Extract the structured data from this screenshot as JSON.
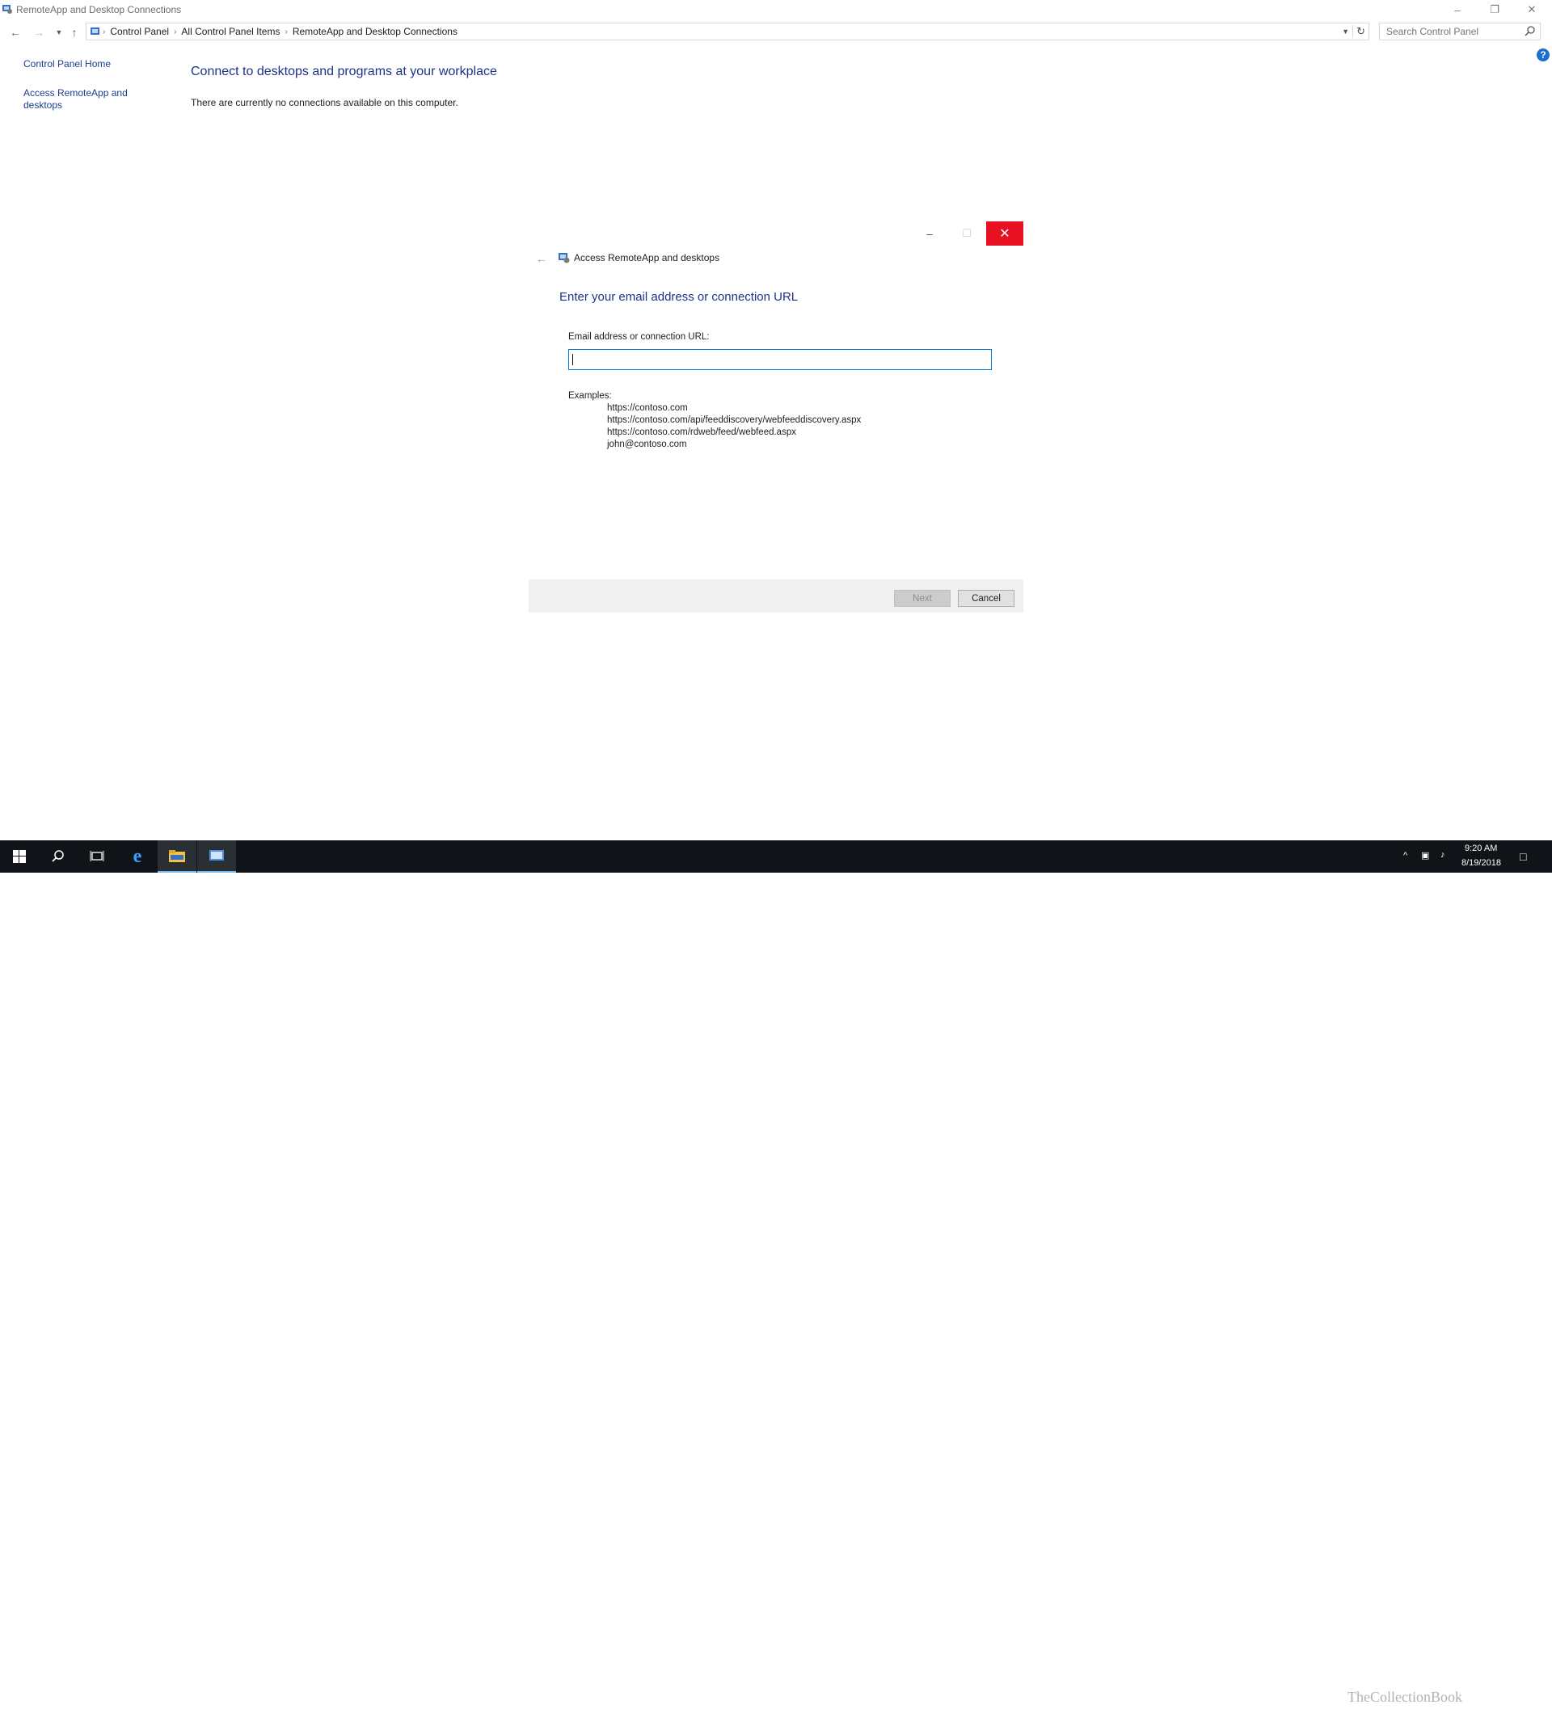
{
  "window": {
    "title": "RemoteApp and Desktop Connections"
  },
  "address": {
    "crumbs": [
      "Control Panel",
      "All Control Panel Items",
      "RemoteApp and Desktop Connections"
    ],
    "search_placeholder": "Search Control Panel"
  },
  "sidebar": {
    "items": [
      {
        "label": "Control Panel Home"
      },
      {
        "label": "Access RemoteApp and desktops"
      }
    ]
  },
  "main": {
    "heading": "Connect to desktops and programs at your workplace",
    "status": "There are currently no connections available on this computer."
  },
  "dialog": {
    "title": "Access RemoteApp and desktops",
    "heading": "Enter your email address or connection URL",
    "field_label": "Email address or connection URL:",
    "field_value": "",
    "examples_label": "Examples:",
    "examples": [
      "https://contoso.com",
      "https://contoso.com/api/feeddiscovery/webfeeddiscovery.aspx",
      "https://contoso.com/rdweb/feed/webfeed.aspx",
      "john@contoso.com"
    ],
    "next_label": "Next",
    "cancel_label": "Cancel"
  },
  "taskbar": {
    "time": "9:20 AM",
    "date": "8/19/2018",
    "watermark": "TheCollectionBook"
  },
  "colors": {
    "link": "#1a3e8c",
    "heading": "#1e3287",
    "close_red": "#e81123",
    "taskbar": "#101418",
    "focus_blue": "#0078d7"
  }
}
